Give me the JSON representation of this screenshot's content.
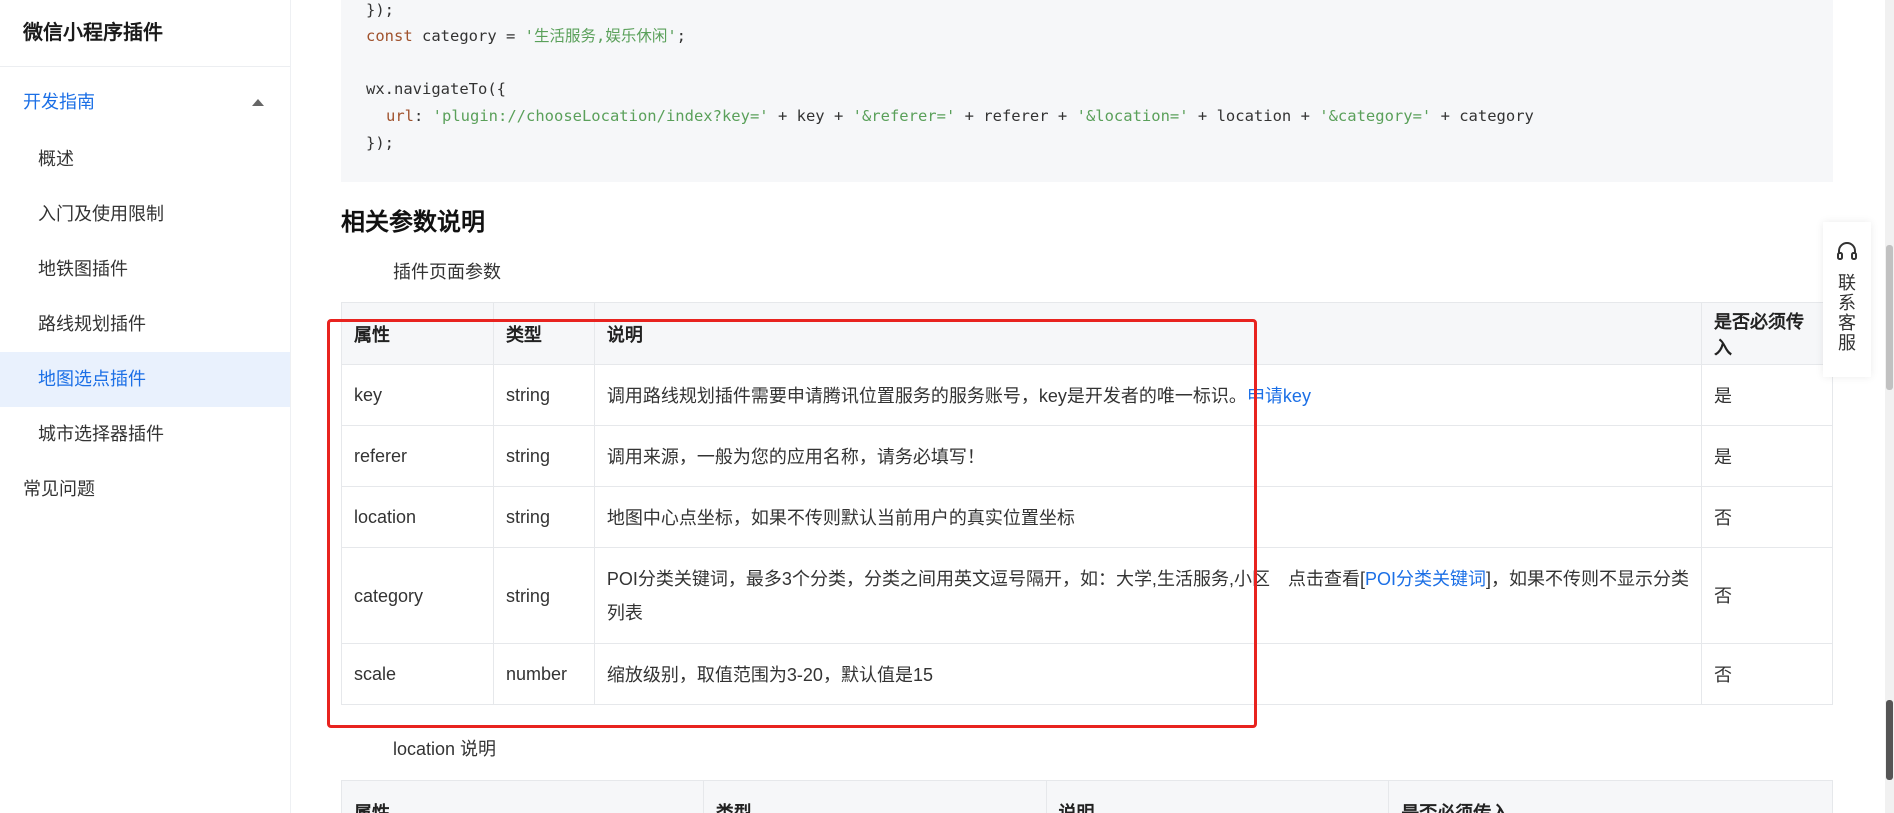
{
  "sidebar": {
    "title": "微信小程序插件",
    "group_label": "开发指南",
    "items": [
      {
        "label": "概述"
      },
      {
        "label": "入门及使用限制"
      },
      {
        "label": "地铁图插件"
      },
      {
        "label": "路线规划插件"
      },
      {
        "label": "地图选点插件"
      },
      {
        "label": "城市选择器插件"
      }
    ],
    "faq_label": "常见问题"
  },
  "code": {
    "line1": "});",
    "line2_kw": "const",
    "line2_var": " category = ",
    "line2_str": "'生活服务,娱乐休闲'",
    "line2_end": ";",
    "line4": "wx.navigateTo({",
    "line5_key": "url",
    "line5_colon": ": ",
    "line5_s1": "'plugin://chooseLocation/index?key='",
    "line5_p1": " + key + ",
    "line5_s2": "'&referer='",
    "line5_p2": " + referer + ",
    "line5_s3": "'&location='",
    "line5_p3": " + location + ",
    "line5_s4": "'&category='",
    "line5_p4": " + category",
    "line6": "});"
  },
  "section_title": "相关参数说明",
  "plugin_params_label": "插件页面参数",
  "params_table": {
    "headers": [
      "属性",
      "类型",
      "说明",
      "是否必须传入"
    ],
    "rows": [
      {
        "attr": "key",
        "type": "string",
        "desc": "调用路线规划插件需要申请腾讯位置服务的服务账号，key是开发者的唯一标识。",
        "link": "申请key",
        "required": "是"
      },
      {
        "attr": "referer",
        "type": "string",
        "desc": "调用来源，一般为您的应用名称，请务必填写！",
        "required": "是"
      },
      {
        "attr": "location",
        "type": "string",
        "desc": "地图中心点坐标，如果不传则默认当前用户的真实位置坐标",
        "required": "否"
      },
      {
        "attr": "category",
        "type": "string",
        "desc_pre": "POI分类关键词，最多3个分类，分类之间用英文逗号隔开，如：大学,生活服务,小区　点击查看[",
        "link": "POI分类关键词",
        "desc_post": "]，如果不传则不显示分类列表",
        "required": "否"
      },
      {
        "attr": "scale",
        "type": "number",
        "desc": "缩放级别，取值范围为3-20，默认值是15",
        "required": "否"
      }
    ]
  },
  "location_label": "location 说明",
  "loc_table": {
    "headers": [
      "属性",
      "类型",
      "说明",
      "是否必须传入"
    ]
  },
  "contact": {
    "label": "联系客服"
  },
  "colors": {
    "accent": "#1b6fe6",
    "highlight": "#e8231f"
  }
}
